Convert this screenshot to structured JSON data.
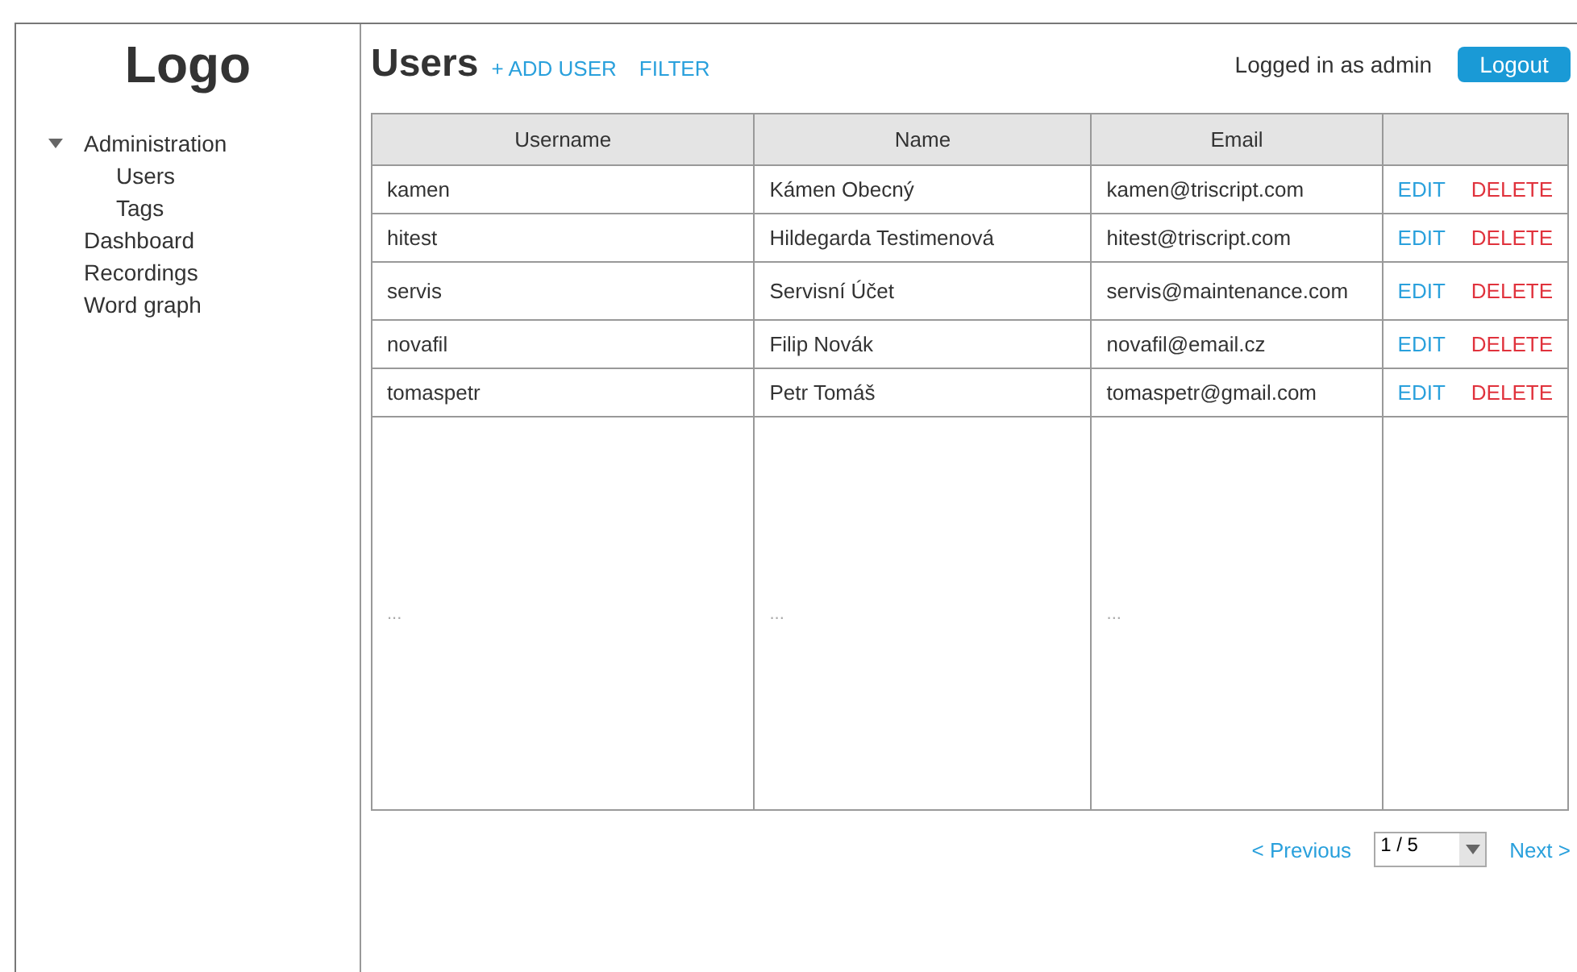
{
  "logo": "Logo",
  "sidebar": {
    "items": [
      {
        "label": "Administration",
        "expanded": true,
        "children": [
          {
            "label": "Users",
            "expanded": false
          },
          {
            "label": "Tags",
            "expanded": false
          }
        ]
      },
      {
        "label": "Dashboard",
        "expanded": false
      },
      {
        "label": "Recordings",
        "expanded": false
      },
      {
        "label": "Word graph",
        "expanded": false
      }
    ]
  },
  "header": {
    "title": "Users",
    "actions": [
      "+ ADD USER",
      "FILTER"
    ],
    "user_text": "Logged in as admin",
    "logout": "Logout"
  },
  "table": {
    "columns": [
      "Username",
      "Name",
      "Email"
    ],
    "rows": [
      {
        "kind": "user",
        "cells": [
          "kamen",
          "Kámen Obecný",
          "kamen@triscript.com"
        ],
        "actions": [
          "EDIT",
          "DELETE"
        ]
      },
      {
        "kind": "user",
        "cells": [
          "hitest",
          "Hildegarda Testimenová",
          "hitest@triscript.com"
        ],
        "actions": [
          "EDIT",
          "DELETE"
        ]
      },
      {
        "kind": "user",
        "cells": [
          "servis",
          "Servisní Účet",
          "servis@maintenance.com"
        ],
        "actions": [
          "EDIT",
          "DELETE"
        ]
      },
      {
        "kind": "user",
        "cells": [
          "novafil",
          "Filip Novák",
          "novafil@email.cz"
        ],
        "actions": [
          "EDIT",
          "DELETE"
        ]
      },
      {
        "kind": "user",
        "cells": [
          "tomaspetr",
          "Petr Tomáš",
          "tomaspetr@gmail.com"
        ],
        "actions": [
          "EDIT",
          "DELETE"
        ]
      },
      {
        "kind": "more",
        "cells": [
          "...",
          "...",
          "..."
        ]
      }
    ]
  },
  "pagination": {
    "previous": "< Previous",
    "page": "1 / 5",
    "next": "Next >"
  }
}
